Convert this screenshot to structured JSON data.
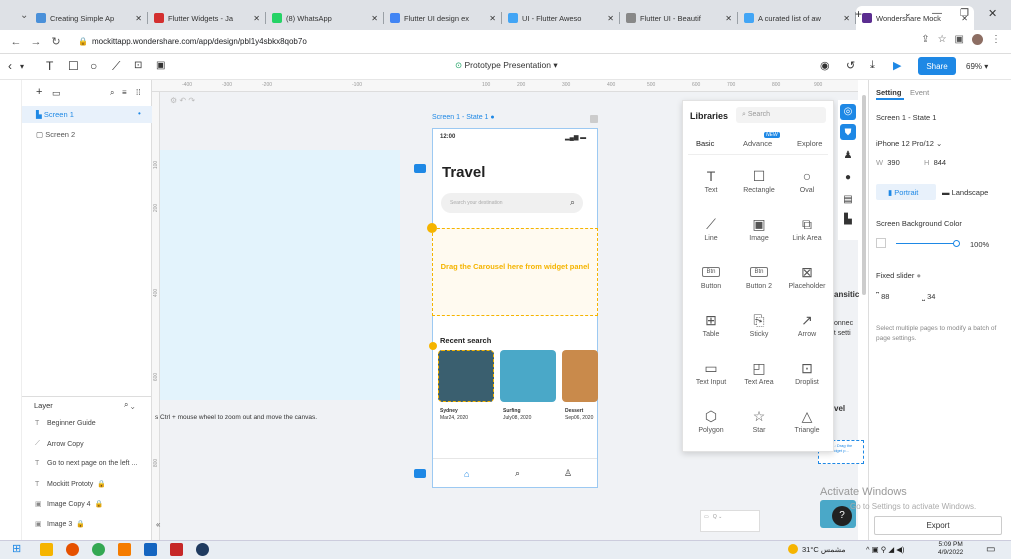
{
  "browser": {
    "tabs": [
      {
        "title": "Creating Simple Ap",
        "color": "#4a90d9"
      },
      {
        "title": "Flutter Widgets - Ja",
        "color": "#d32f2f"
      },
      {
        "title": "(8) WhatsApp",
        "color": "#25d366"
      },
      {
        "title": "Flutter UI design ex",
        "color": "#4285f4"
      },
      {
        "title": "UI - Flutter Aweso",
        "color": "#42a5f5"
      },
      {
        "title": "Flutter UI - Beautif",
        "color": "#888888"
      },
      {
        "title": "A curated list of aw",
        "color": "#42a5f5"
      },
      {
        "title": "Wondershare Mock",
        "color": "#5b2d90"
      }
    ],
    "url": "mockittapp.wondershare.com/app/design/pbl1y4sbkx8qob7o"
  },
  "toolbar": {
    "presentation_label": "Prototype Presentation",
    "share_label": "Share",
    "zoom": "69%"
  },
  "left_panel": {
    "screens": [
      "Screen 1",
      "Screen 2"
    ],
    "layer_title": "Layer",
    "layers": [
      "Beginner Guide",
      "Arrow Copy",
      "Go to next page on the left ...",
      "Mockitt Prototy",
      "Image Copy 4",
      "Image 3"
    ]
  },
  "canvas": {
    "ruler_top": [
      "-400",
      "-300",
      "-200",
      "-100",
      "100",
      "200",
      "300",
      "400",
      "500",
      "600",
      "700",
      "800",
      "900"
    ],
    "ruler_left": [
      "100",
      "200",
      "400",
      "600",
      "800"
    ],
    "hint": "s Ctrl + mouse wheel to zoom out and move the canvas.",
    "screen_label": "Screen 1 - State 1"
  },
  "phone": {
    "time": "12:00",
    "title": "Travel",
    "search_placeholder": "Search your destination",
    "carousel_hint": "Drag the Carousel here from widget panel",
    "recent_label": "Recent search",
    "cards": [
      {
        "name": "Sydney",
        "date": "Mar24, 2020",
        "color": "#3a5f6f"
      },
      {
        "name": "Surfing",
        "date": "July08, 2020",
        "color": "#4aa8c8"
      },
      {
        "name": "Dessert",
        "date": "Sep06, 2020",
        "color": "#c98a4b"
      }
    ]
  },
  "libraries": {
    "title": "Libraries",
    "search_placeholder": "Search",
    "tabs": [
      "Basic",
      "Advance",
      "Explore"
    ],
    "new_badge": "NEW",
    "items": [
      {
        "label": "Text",
        "icon": "T"
      },
      {
        "label": "Rectangle",
        "icon": "☐"
      },
      {
        "label": "Oval",
        "icon": "○"
      },
      {
        "label": "Line",
        "icon": "⟋"
      },
      {
        "label": "Image",
        "icon": "▣"
      },
      {
        "label": "Link Area",
        "icon": "⧉"
      },
      {
        "label": "Button",
        "icon": "Btn"
      },
      {
        "label": "Button 2",
        "icon": "Btn"
      },
      {
        "label": "Placeholder",
        "icon": "⊠"
      },
      {
        "label": "Table",
        "icon": "⊞"
      },
      {
        "label": "Sticky",
        "icon": "⎘"
      },
      {
        "label": "Arrow",
        "icon": "↗"
      },
      {
        "label": "Text Input",
        "icon": "▭"
      },
      {
        "label": "Text Area",
        "icon": "◰"
      },
      {
        "label": "Droplist",
        "icon": "⊡"
      },
      {
        "label": "Polygon",
        "icon": "⬡"
      },
      {
        "label": "Star",
        "icon": "☆"
      },
      {
        "label": "Triangle",
        "icon": "△"
      }
    ]
  },
  "partial": {
    "transition": "ansitic",
    "connect": "onnec",
    "settings": "nt setti",
    "level": "vel",
    "step": "STEP 1: Drag the Ca... widget p..."
  },
  "right_panel": {
    "tabs": [
      "Setting",
      "Event"
    ],
    "screen_name": "Screen 1 - State 1",
    "device": "iPhone 12 Pro/12",
    "w_label": "W",
    "w_value": "390",
    "h_label": "H",
    "h_value": "844",
    "portrait": "Portrait",
    "landscape": "Landscape",
    "bg_color_label": "Screen Background Color",
    "opacity": "100%",
    "fixed_slider_label": "Fixed slider",
    "fixed_top": "88",
    "fixed_bottom": "34",
    "multi_hint": "Select multiple pages to modify a batch of page settings.",
    "activate_title": "Activate Windows",
    "activate_sub": "Go to Settings to activate Windows.",
    "export_label": "Export"
  },
  "taskbar": {
    "temperature": "31°C",
    "weather": "مشمس",
    "time": "5:09 PM",
    "date": "4/9/2022"
  }
}
